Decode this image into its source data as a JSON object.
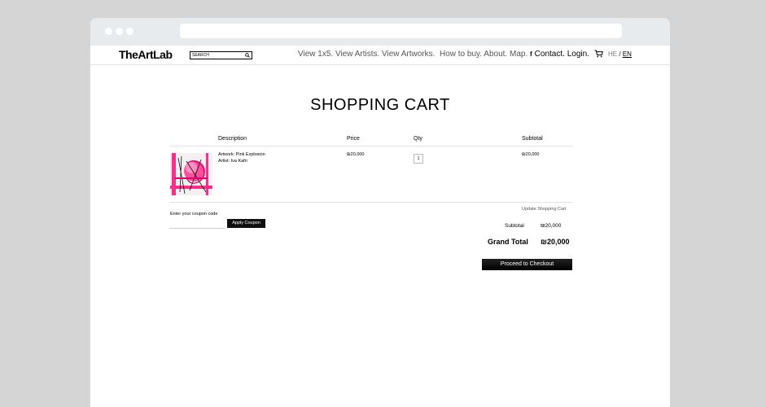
{
  "site": {
    "logo": "TheArtLab",
    "search_placeholder": "SEARCH",
    "nav": [
      "View 1x5.",
      "View Artists.",
      "View Artworks.",
      "How to buy.",
      "About.",
      "Map."
    ],
    "facebook_glyph": "f",
    "contact": "Contact.",
    "login": "Login.",
    "lang_he": "HE",
    "lang_sep": "/",
    "lang_en": "EN"
  },
  "page": {
    "title": "SHOPPING CART"
  },
  "cart": {
    "headers": {
      "description": "Description",
      "price": "Price",
      "qty": "Qty",
      "subtotal": "Subtotal"
    },
    "items": [
      {
        "artwork": "Artwork: Pink Explosion",
        "artist": "Artist: Iva Kafri",
        "price": "₪20,000",
        "qty": "1",
        "subtotal": "₪20,000"
      }
    ],
    "update_label": "Update Shopping Cart",
    "coupon_label": "Enter your coupon code",
    "apply_label": "Apply Coupon",
    "subtotal_label": "Subtotal",
    "subtotal_value": "₪20,000",
    "grand_total_label": "Grand Total",
    "grand_total_value": "₪20,000",
    "checkout_label": "Proceed to Checkout"
  },
  "colors": {
    "background": "#d5d5d5",
    "accent": "#ff2d8a"
  }
}
